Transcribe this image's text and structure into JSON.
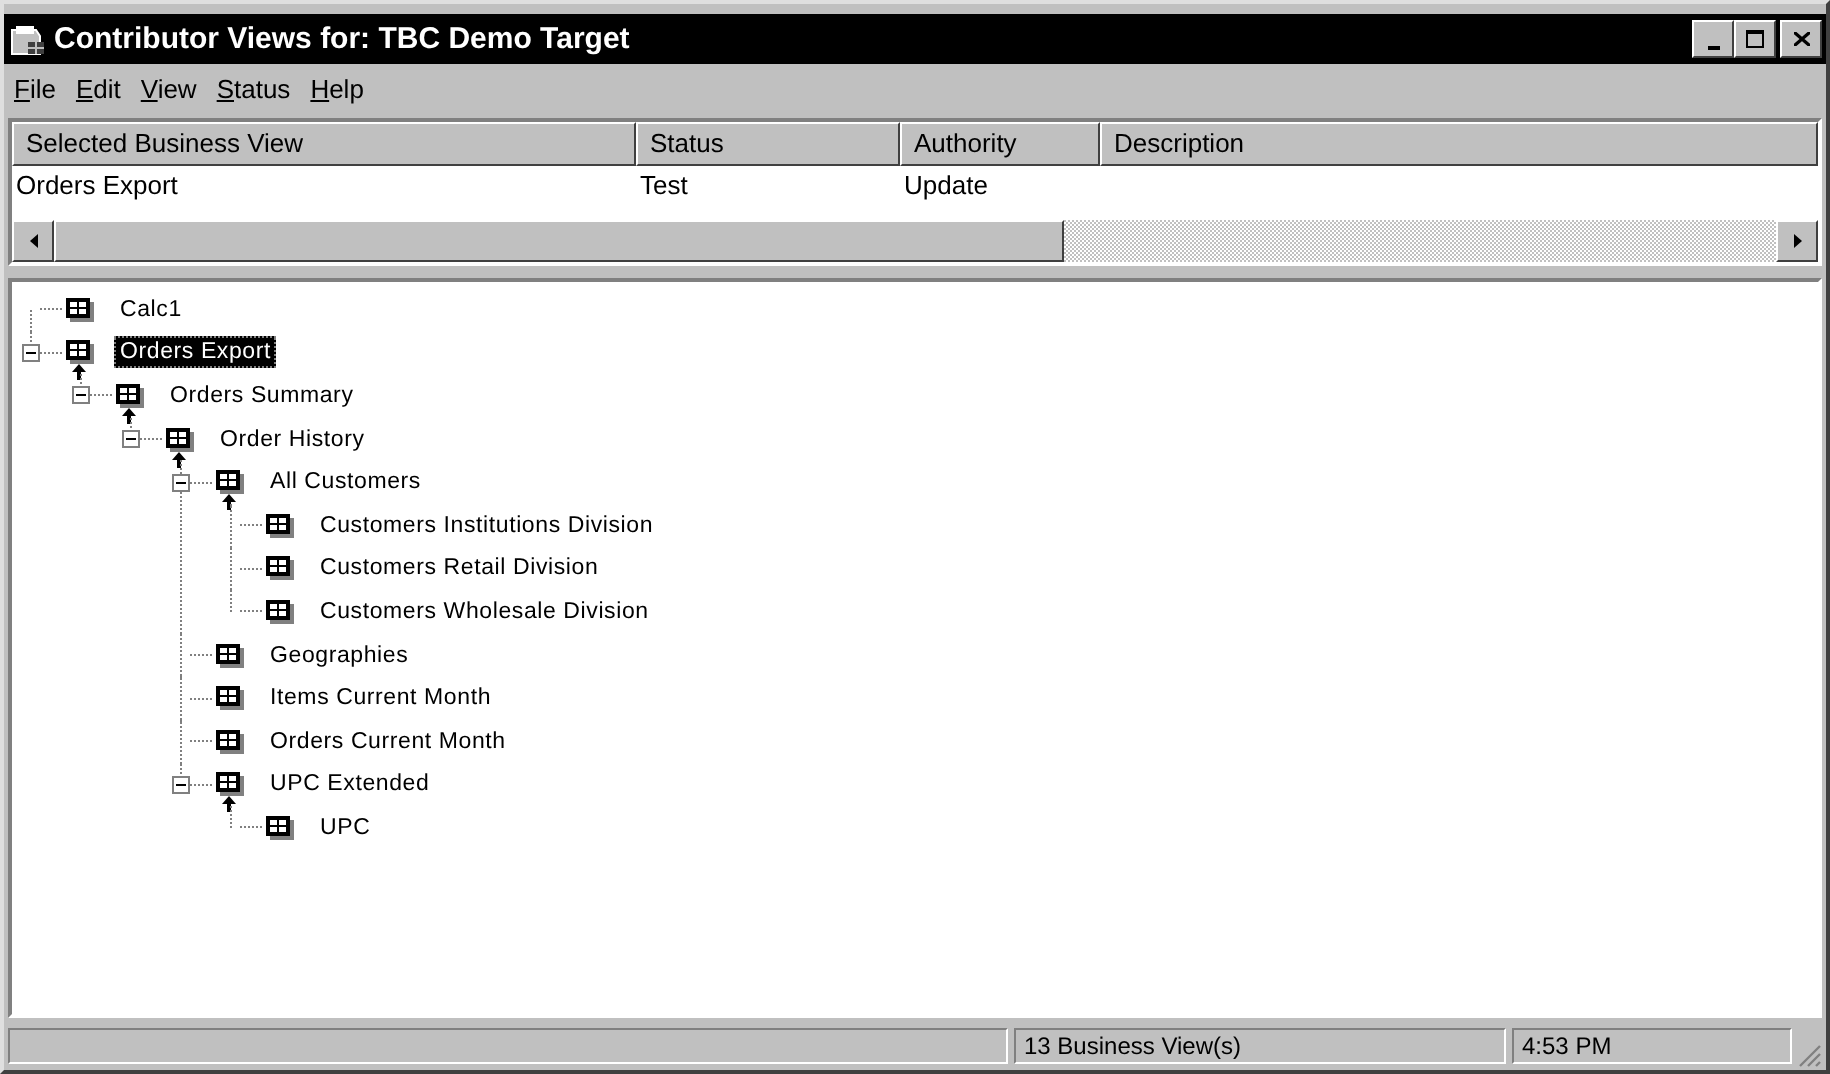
{
  "window": {
    "title": "Contributor Views for: TBC Demo Target"
  },
  "menu": [
    "File",
    "Edit",
    "View",
    "Status",
    "Help"
  ],
  "table": {
    "columns": [
      "Selected Business View",
      "Status",
      "Authority",
      "Description"
    ],
    "rows": [
      {
        "cells": [
          "Orders Export",
          "Test",
          "Update"
        ],
        "selected": false
      }
    ]
  },
  "tree": [
    {
      "label": "Calc1",
      "selected": false
    },
    {
      "label": "Orders Export",
      "selected": true,
      "expanded": true,
      "children": [
        {
          "label": "Orders Summary",
          "selected": false,
          "expanded": true,
          "children": [
            {
              "label": "Order History",
              "selected": false,
              "expanded": true,
              "children": [
                {
                  "label": "All Customers",
                  "selected": false,
                  "expanded": true,
                  "children": [
                    {
                      "label": "Customers Institutions Division",
                      "selected": false
                    },
                    {
                      "label": "Customers Retail Division",
                      "selected": false
                    },
                    {
                      "label": "Customers Wholesale Division",
                      "selected": false
                    }
                  ]
                },
                {
                  "label": "Geographies",
                  "selected": false
                },
                {
                  "label": "Items Current Month",
                  "selected": false
                },
                {
                  "label": "Orders Current Month",
                  "selected": false
                },
                {
                  "label": "UPC Extended",
                  "selected": false,
                  "expanded": true,
                  "children": [
                    {
                      "label": "UPC",
                      "selected": false
                    }
                  ]
                }
              ]
            }
          ]
        }
      ]
    }
  ],
  "status_bar": [
    "13 Business View(s)",
    "4:53 PM"
  ]
}
